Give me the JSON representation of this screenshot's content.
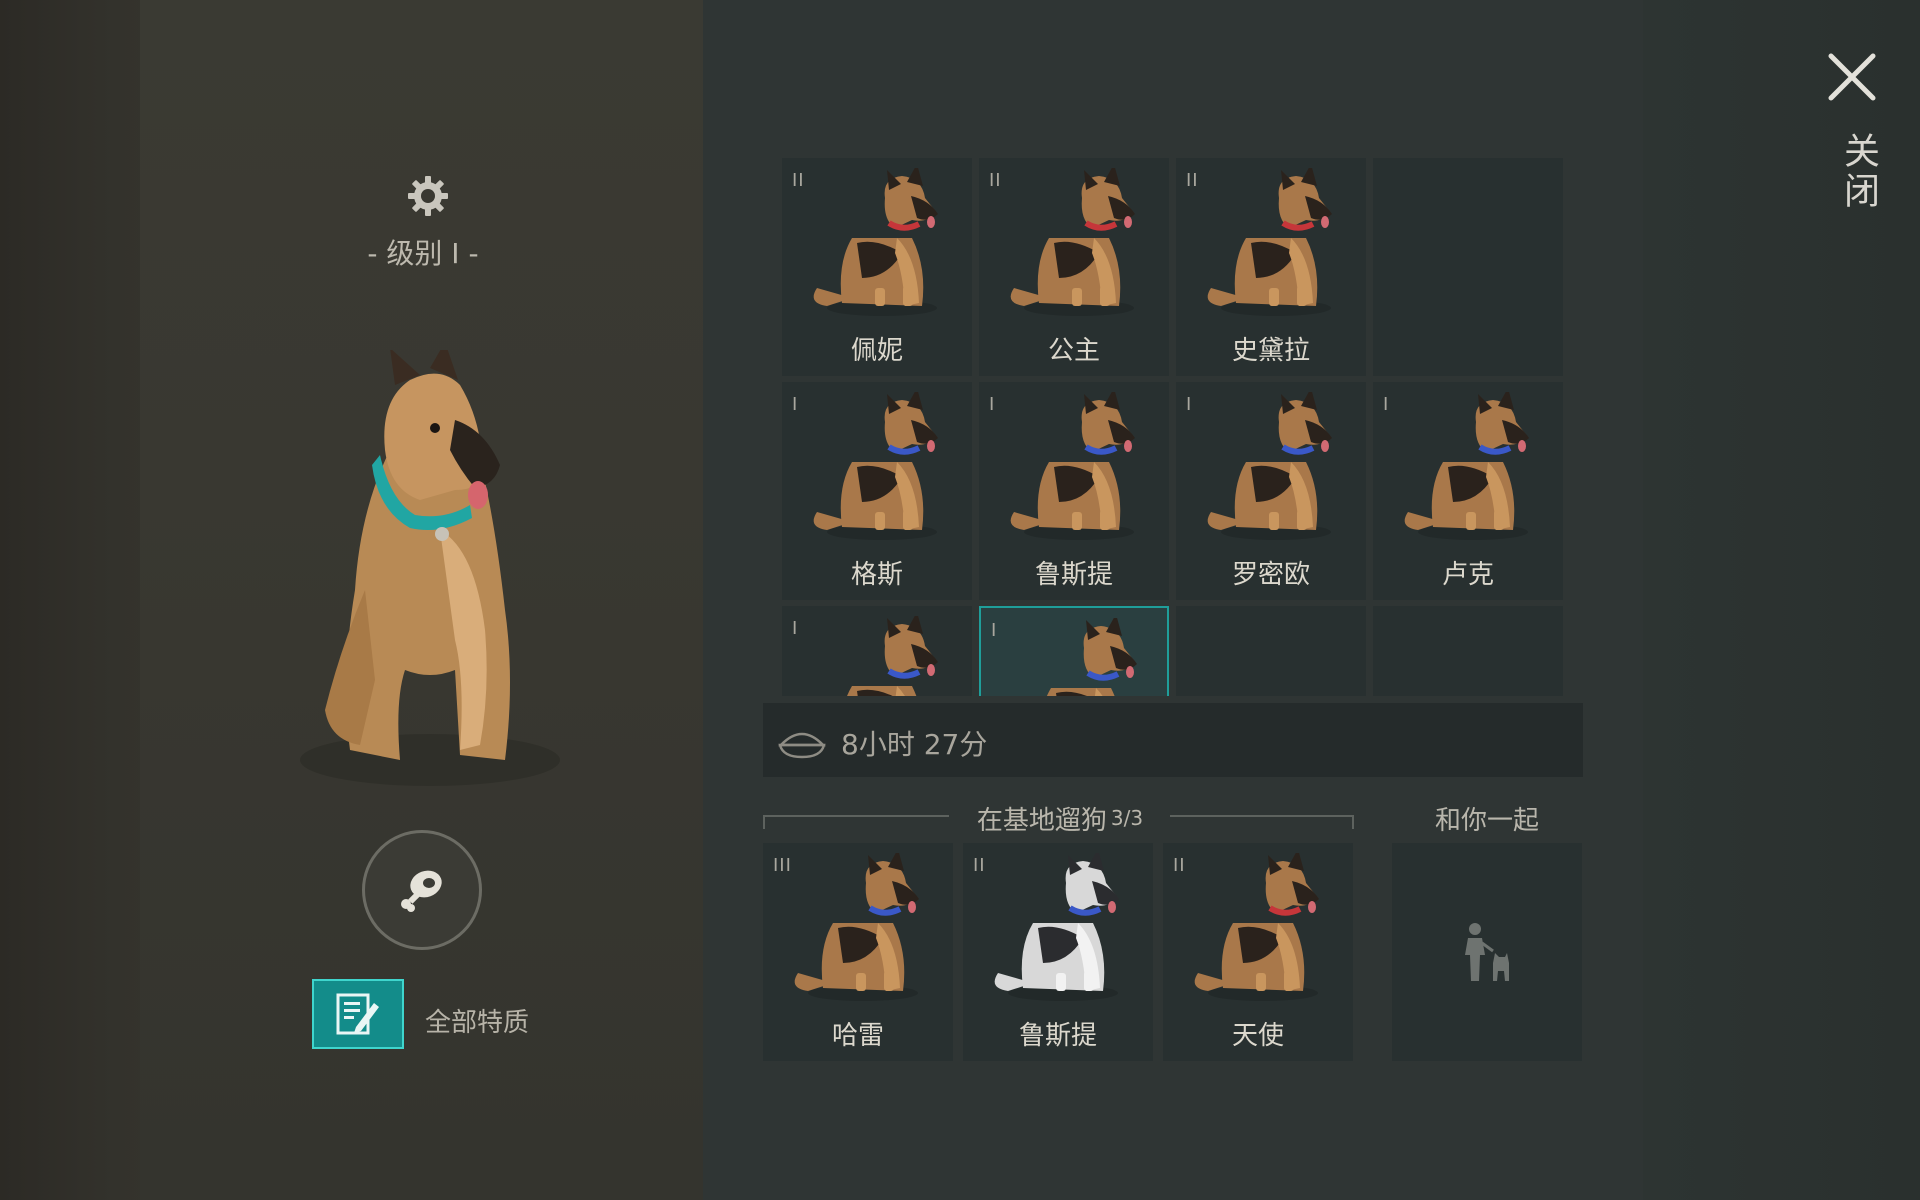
{
  "profile": {
    "level_label": "- 级别 I -",
    "traits_label": "全部特质"
  },
  "kennel": {
    "rows": [
      [
        {
          "tier": "II",
          "name": "佩妮",
          "collar": "#c6363a"
        },
        {
          "tier": "II",
          "name": "公主",
          "collar": "#c6363a"
        },
        {
          "tier": "II",
          "name": "史黛拉",
          "collar": "#c6363a"
        },
        {
          "tier": "",
          "name": "",
          "collar": ""
        }
      ],
      [
        {
          "tier": "I",
          "name": "格斯",
          "collar": "#3a58c8"
        },
        {
          "tier": "I",
          "name": "鲁斯提",
          "collar": "#3a58c8"
        },
        {
          "tier": "I",
          "name": "罗密欧",
          "collar": "#3a58c8"
        },
        {
          "tier": "I",
          "name": "卢克",
          "collar": "#3a58c8"
        }
      ],
      [
        {
          "tier": "I",
          "name": "",
          "collar": "#3a58c8"
        },
        {
          "tier": "I",
          "name": "",
          "collar": "#3a58c8",
          "selected": true
        },
        {
          "tier": "",
          "name": "",
          "collar": ""
        },
        {
          "tier": "",
          "name": "",
          "collar": ""
        }
      ]
    ]
  },
  "timer": {
    "text": "8小时 27分"
  },
  "walking": {
    "title": "在基地遛狗",
    "count": "3/3",
    "dogs": [
      {
        "tier": "III",
        "name": "哈雷",
        "collar": "#3a58c8",
        "breed": "shepherd"
      },
      {
        "tier": "II",
        "name": "鲁斯提",
        "collar": "#3a58c8",
        "breed": "husky"
      },
      {
        "tier": "II",
        "name": "天使",
        "collar": "#c6363a",
        "breed": "shepherd"
      }
    ]
  },
  "companion": {
    "title": "和你一起"
  },
  "close": {
    "label": "关闭"
  },
  "colors": {
    "accent": "#138c8a",
    "accent_border": "#3fd5cd",
    "selected_border": "#1f9e9a"
  }
}
